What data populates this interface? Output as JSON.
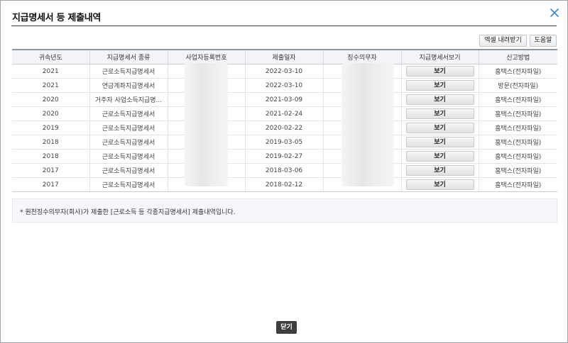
{
  "dialog": {
    "title": "지급명세서 등 제출내역",
    "close_icon": "close-x-icon",
    "accent_color": "#3d87c8"
  },
  "toolbar": {
    "excel_label": "엑셀 내려받기",
    "help_label": "도움말"
  },
  "table": {
    "headers": [
      "귀속년도",
      "지급명세서 종류",
      "사업자등록번호",
      "제출일자",
      "징수의무자",
      "지급명세서보기",
      "신고방법"
    ],
    "view_label": "보기",
    "rows": [
      {
        "year": "2021",
        "kind": "근로소득지급명세서",
        "biz_no": "",
        "submit_date": "2022-03-10",
        "payer": "",
        "method": "홈택스(전자파일)"
      },
      {
        "year": "2021",
        "kind": "연금계좌지급명세서",
        "biz_no": "",
        "submit_date": "2022-03-10",
        "payer": "",
        "method": "방문(전자파일)"
      },
      {
        "year": "2020",
        "kind": "거주자 사업소득지급명...",
        "biz_no": "",
        "submit_date": "2021-03-09",
        "payer": "",
        "method": "홈택스(전자파일)"
      },
      {
        "year": "2020",
        "kind": "근로소득지급명세서",
        "biz_no": "",
        "submit_date": "2021-02-24",
        "payer": "",
        "method": "홈택스(전자파일)"
      },
      {
        "year": "2019",
        "kind": "근로소득지급명세서",
        "biz_no": "",
        "submit_date": "2020-02-22",
        "payer": "",
        "method": "홈택스(전자파일)"
      },
      {
        "year": "2018",
        "kind": "근로소득지급명세서",
        "biz_no": "",
        "submit_date": "2019-03-05",
        "payer": "",
        "method": "홈택스(전자파일)"
      },
      {
        "year": "2018",
        "kind": "근로소득지급명세서",
        "biz_no": "",
        "submit_date": "2019-02-27",
        "payer": "",
        "method": "홈택스(전자파일)"
      },
      {
        "year": "2017",
        "kind": "근로소득지급명세서",
        "biz_no": "",
        "submit_date": "2018-03-06",
        "payer": "",
        "method": "홈택스(전자파일)"
      },
      {
        "year": "2017",
        "kind": "근로소득지급명세서",
        "biz_no": "",
        "submit_date": "2018-02-12",
        "payer": "",
        "method": "홈택스(전자파일)"
      }
    ]
  },
  "notice": {
    "text": "* 원천징수의무자(회사)가 제출한 [근로소득 등 각종지급명세서] 제출내역입니다."
  },
  "footer": {
    "close_label": "닫기"
  }
}
